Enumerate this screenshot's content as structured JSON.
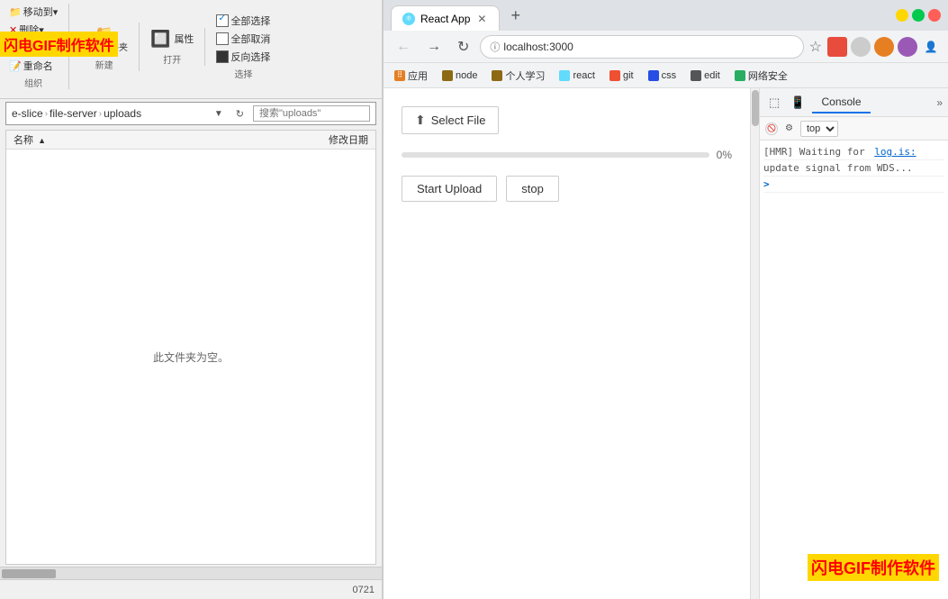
{
  "watermark_top": "闪电GIF制作软件",
  "watermark_bottom": "闪电GIF制作软件",
  "explorer": {
    "ribbon": {
      "move_to": "移动到▾",
      "delete": "删除▾",
      "delete_icon": "✕",
      "copy_to": "复制到▾",
      "rename": "重命名",
      "new_folder_label": "新建\n文件夹",
      "properties": "属性",
      "select_all": "全部选择",
      "deselect": "全部取消",
      "invert": "反向选择",
      "group_organize": "组织",
      "group_new": "新建",
      "group_open": "打开",
      "group_select": "选择"
    },
    "address": {
      "parts": [
        "e-slice",
        "file-server",
        "uploads"
      ],
      "search_placeholder": "搜索\"uploads\""
    },
    "columns": {
      "name": "名称",
      "date": "修改日期"
    },
    "empty_message": "此文件夹为空。"
  },
  "browser": {
    "tab_title": "React App",
    "url": "localhost:3000",
    "bookmarks": [
      {
        "label": "应用",
        "color": "#e67e22"
      },
      {
        "label": "node",
        "color": "#8e6914"
      },
      {
        "label": "个人学习",
        "color": "#8e6914"
      },
      {
        "label": "react",
        "color": "#8e6914"
      },
      {
        "label": "git",
        "color": "#8e6914"
      },
      {
        "label": "css",
        "color": "#8e6914"
      },
      {
        "label": "edit",
        "color": "#8e6914"
      },
      {
        "label": "网络安全",
        "color": "#8e6914"
      }
    ],
    "react_app": {
      "select_file_btn": "Select File",
      "progress_percent": "0%",
      "progress_value": 0,
      "start_upload_btn": "Start Upload",
      "stop_btn": "stop"
    },
    "devtools": {
      "console_tab": "Console",
      "more_label": "»",
      "filter_top": "top",
      "console_lines": [
        "[HMR] Waiting for  log.is:",
        "update signal from WDS..."
      ],
      "prompt": ">"
    }
  }
}
